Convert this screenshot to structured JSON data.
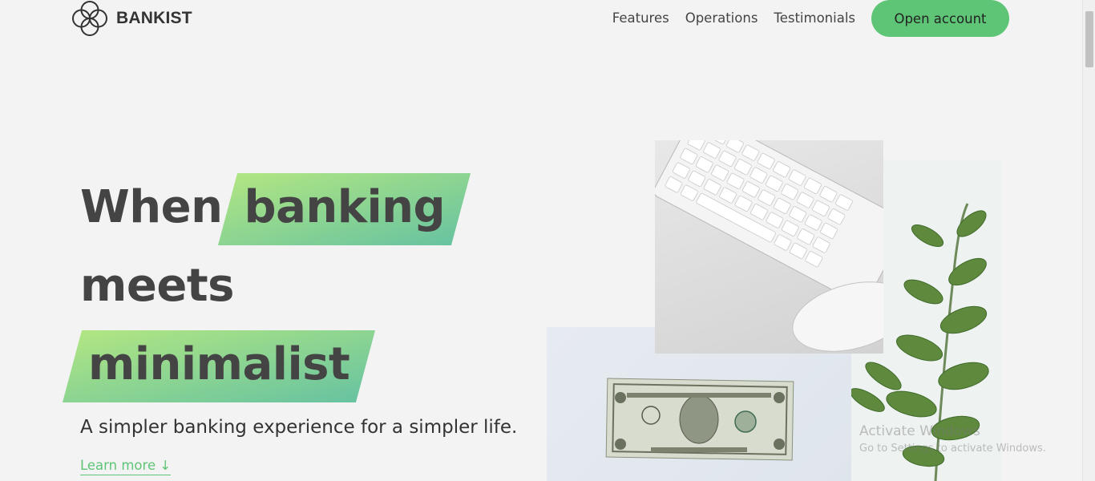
{
  "brand": {
    "name": "BANKIST",
    "logo_icon": "four-circles-logo-icon"
  },
  "nav": {
    "links": [
      "Features",
      "Operations",
      "Testimonials"
    ],
    "cta": "Open account"
  },
  "hero": {
    "title_word1": "When",
    "title_highlight1": "banking",
    "title_line2": "meets",
    "title_highlight2": "minimalist",
    "subtitle": "A simpler banking experience for a simpler life.",
    "learn_more": "Learn more ↓"
  },
  "watermark": {
    "line1": "Activate Windows",
    "line2": "Go to Settings to activate Windows."
  },
  "colors": {
    "accent": "#5ec576",
    "gradient_from": "#9be15d",
    "gradient_to": "#39b385",
    "background": "#f3f3f3"
  }
}
